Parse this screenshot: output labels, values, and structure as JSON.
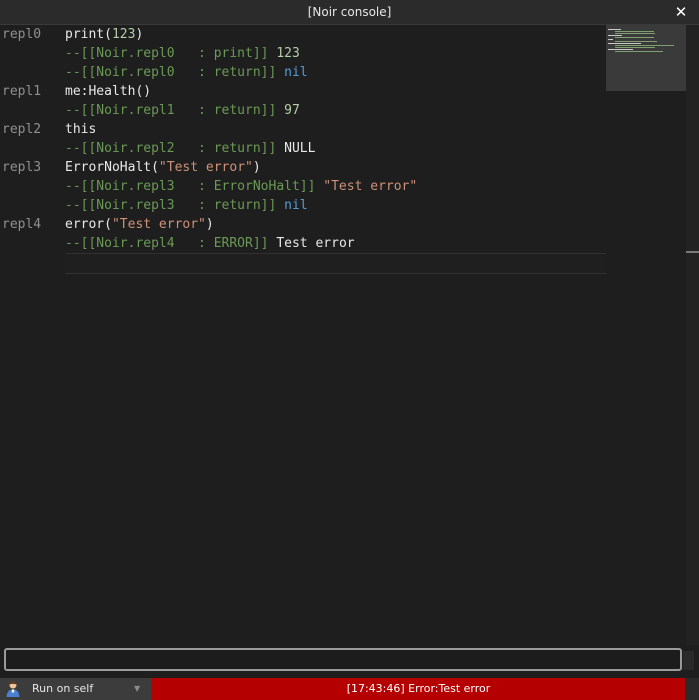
{
  "window": {
    "title": "[Noir console]",
    "close_icon": "close-icon"
  },
  "console": {
    "lines": [
      {
        "gutter": "repl0",
        "segments": [
          {
            "t": "p",
            "v": "print("
          },
          {
            "t": "n",
            "v": "123"
          },
          {
            "t": "p",
            "v": ")"
          }
        ]
      },
      {
        "gutter": "",
        "segments": [
          {
            "t": "c",
            "v": "--[[Noir.repl0   : print]] "
          },
          {
            "t": "n",
            "v": "123"
          }
        ]
      },
      {
        "gutter": "",
        "segments": [
          {
            "t": "c",
            "v": "--[[Noir.repl0   : return]] "
          },
          {
            "t": "k",
            "v": "nil"
          }
        ]
      },
      {
        "gutter": "repl1",
        "segments": [
          {
            "t": "p",
            "v": "me:Health()"
          }
        ]
      },
      {
        "gutter": "",
        "segments": [
          {
            "t": "c",
            "v": "--[[Noir.repl1   : return]] "
          },
          {
            "t": "n",
            "v": "97"
          }
        ]
      },
      {
        "gutter": "repl2",
        "segments": [
          {
            "t": "p",
            "v": "this"
          }
        ]
      },
      {
        "gutter": "",
        "segments": [
          {
            "t": "c",
            "v": "--[[Noir.repl2   : return]] "
          },
          {
            "t": "p",
            "v": "NULL"
          }
        ]
      },
      {
        "gutter": "repl3",
        "segments": [
          {
            "t": "p",
            "v": "ErrorNoHalt("
          },
          {
            "t": "s",
            "v": "\"Test error\""
          },
          {
            "t": "p",
            "v": ")"
          }
        ]
      },
      {
        "gutter": "",
        "segments": [
          {
            "t": "c",
            "v": "--[[Noir.repl3   : ErrorNoHalt]] "
          },
          {
            "t": "s",
            "v": "\"Test error\""
          }
        ]
      },
      {
        "gutter": "",
        "segments": [
          {
            "t": "c",
            "v": "--[[Noir.repl3   : return]] "
          },
          {
            "t": "k",
            "v": "nil"
          }
        ]
      },
      {
        "gutter": "repl4",
        "segments": [
          {
            "t": "p",
            "v": "error("
          },
          {
            "t": "s",
            "v": "\"Test error\""
          },
          {
            "t": "p",
            "v": ")"
          }
        ]
      },
      {
        "gutter": "",
        "segments": [
          {
            "t": "c",
            "v": "--[[Noir.repl4   : ERROR]] "
          },
          {
            "t": "p",
            "v": "Test error"
          }
        ]
      }
    ]
  },
  "input": {
    "value": "",
    "placeholder": ""
  },
  "statusbar": {
    "run_target": "Run on self",
    "run_icon": "user-icon",
    "dropdown_icon": "chevron-down-icon",
    "message": "[17:43:46] Error:Test error"
  },
  "colors": {
    "comment": "#6a9955",
    "number": "#b5cea8",
    "string": "#ce9178",
    "keyword": "#569cd6",
    "plain": "#e8e8e8",
    "error_bar": "#b40000"
  }
}
